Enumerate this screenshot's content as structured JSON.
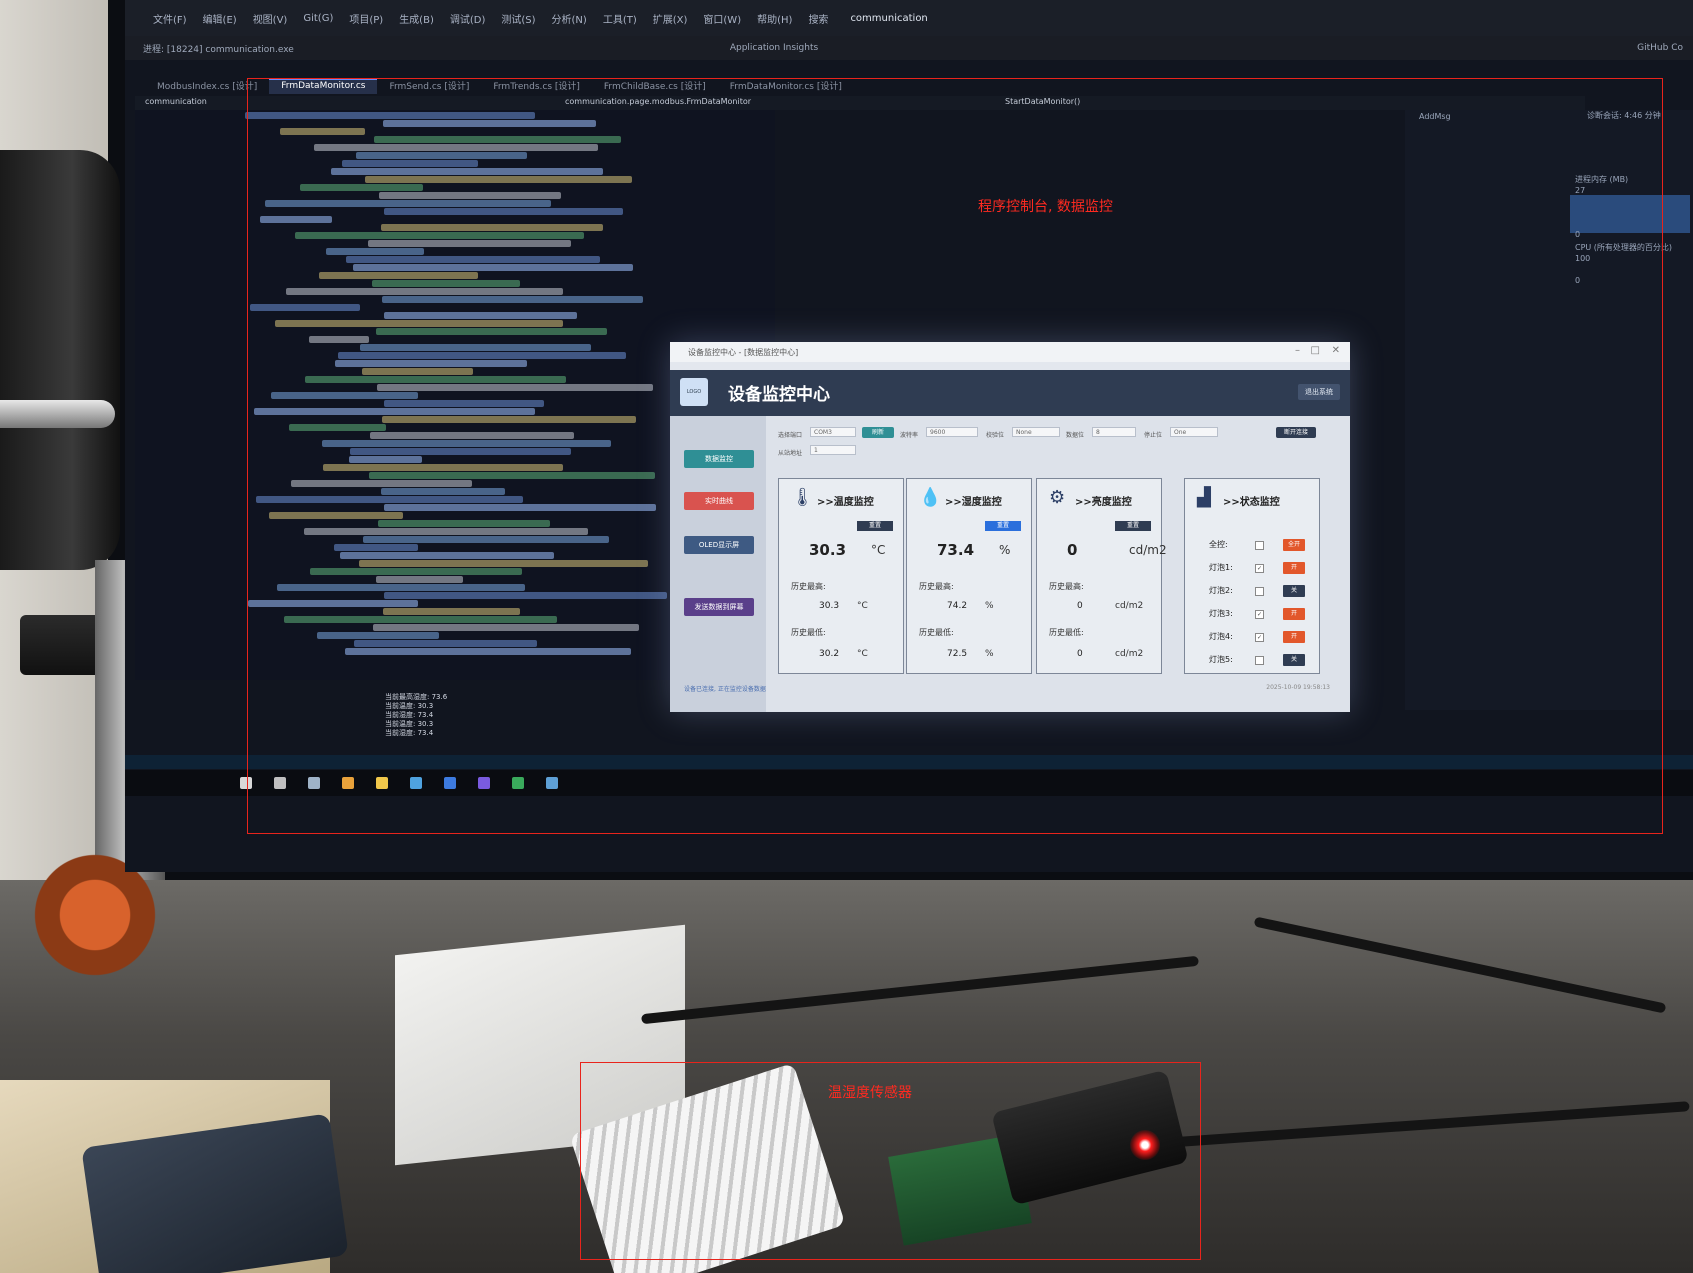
{
  "ide": {
    "solution_name": "communication",
    "menu_items": [
      "文件(F)",
      "编辑(E)",
      "视图(V)",
      "Git(G)",
      "项目(P)",
      "生成(B)",
      "调试(D)",
      "测试(S)",
      "分析(N)",
      "工具(T)",
      "扩展(X)",
      "窗口(W)",
      "帮助(H)",
      "搜索"
    ],
    "process_label": "进程: [18224] communication.exe",
    "insights_label": "Application Insights",
    "github_label": "GitHub Co",
    "tabs": [
      "ModbusIndex.cs [设计]",
      "FrmDataMonitor.cs",
      "FrmSend.cs [设计]",
      "FrmTrends.cs [设计]",
      "FrmChildBase.cs [设计]",
      "FrmDataMonitor.cs [设计]"
    ],
    "active_tab_index": 1,
    "nav_project": "communication",
    "nav_class": "communication.page.modbus.FrmDataMonitor",
    "nav_method": "StartDataMonitor()",
    "right_panel": {
      "add_msg": "AddMsg",
      "session": "诊断会话: 4:46 分钟",
      "cpu_label": "CPU (所有处理器的百分比)",
      "memory_label": "进程内存 (MB)",
      "cpu_value": "100",
      "mem_value": "27",
      "zero": "0"
    },
    "output_lines": [
      "当前最高湿度: 73.6",
      "当前温度: 30.3",
      "当前湿度: 73.4",
      "当前温度: 30.3",
      "当前湿度: 73.4"
    ]
  },
  "app": {
    "window_title": "设备监控中心 - [数据监控中心]",
    "title": "设备监控中心",
    "exit_label": "退出系统",
    "nav_buttons": [
      {
        "label": "数据监控",
        "color": "#2f8f95"
      },
      {
        "label": "实时曲线",
        "color": "#d9534f"
      },
      {
        "label": "OLED显示屏",
        "color": "#3e5a83"
      },
      {
        "label": "发送数据到屏幕",
        "color": "#5a3f8a"
      }
    ],
    "config": {
      "port_label": "选择端口",
      "port_value": "COM3",
      "refresh_label": "刷新",
      "baud_label": "波特率",
      "baud_value": "9600",
      "parity_label": "校验位",
      "parity_value": "None",
      "databits_label": "数据位",
      "databits_value": "8",
      "stopbits_label": "停止位",
      "stopbits_value": "One",
      "slave_label": "从站地址",
      "slave_value": "1",
      "connect_label": "断开连接"
    },
    "panels": [
      {
        "title": ">>温度监控",
        "icon": "thermometer-icon",
        "glyph": "🌡",
        "badge": "重置",
        "badge_color": "#2f3c52",
        "value": "30.3",
        "unit": "°C",
        "high_label": "历史最高:",
        "high": "30.3",
        "low_label": "历史最低:",
        "low": "30.2",
        "hist_unit": "°C"
      },
      {
        "title": ">>湿度监控",
        "icon": "water-drop-icon",
        "glyph": "💧",
        "badge": "重置",
        "badge_color": "#2a6fdc",
        "value": "73.4",
        "unit": "%",
        "high_label": "历史最高:",
        "high": "74.2",
        "low_label": "历史最低:",
        "low": "72.5",
        "hist_unit": "%"
      },
      {
        "title": ">>亮度监控",
        "icon": "gear-icon",
        "glyph": "⚙",
        "badge": "重置",
        "badge_color": "#2f3c52",
        "value": "0",
        "unit": "cd/m2",
        "high_label": "历史最高:",
        "high": "0",
        "low_label": "历史最低:",
        "low": "0",
        "hist_unit": "cd/m2"
      }
    ],
    "status_panel": {
      "title": ">>状态监控",
      "rows": [
        {
          "label": "全控:",
          "checked": false,
          "button": "全开",
          "color": "#e2572b"
        },
        {
          "label": "灯泡1:",
          "checked": true,
          "button": "开",
          "color": "#e2572b"
        },
        {
          "label": "灯泡2:",
          "checked": false,
          "button": "关",
          "color": "#2f3c52"
        },
        {
          "label": "灯泡3:",
          "checked": true,
          "button": "开",
          "color": "#e2572b"
        },
        {
          "label": "灯泡4:",
          "checked": true,
          "button": "开",
          "color": "#e2572b"
        },
        {
          "label": "灯泡5:",
          "checked": false,
          "button": "关",
          "color": "#2f3c52"
        }
      ]
    },
    "footer_message": "设备已连接, 正在监控设备数据",
    "footer_time": "2025-10-09 19:58:13"
  },
  "annotations": {
    "top_label": "程序控制台, 数据监控",
    "bottom_label": "温湿度传感器",
    "color": "#e8241c"
  }
}
